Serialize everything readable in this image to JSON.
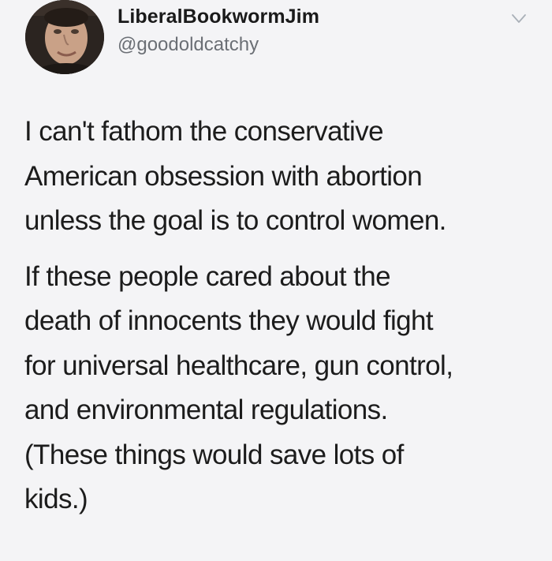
{
  "tweet": {
    "author": {
      "display_name": "LiberalBookwormJim",
      "handle": "@goodoldcatchy",
      "avatar_icon": "profile-photo"
    },
    "menu_icon": "chevron-down-icon",
    "paragraphs": [
      {
        "lines": [
          "I can't fathom the conservative",
          "American obsession with abortion",
          "unless the goal is to control women."
        ]
      },
      {
        "lines": [
          "If these people cared about the",
          "death of innocents they would fight",
          "for universal healthcare, gun control,",
          "and environmental regulations.",
          "(These things would save lots of",
          "kids.)"
        ]
      }
    ]
  },
  "colors": {
    "background": "#f4f4f6",
    "text": "#1c1c1c",
    "handle": "#6b6f75",
    "caret": "#a9b0b8"
  }
}
